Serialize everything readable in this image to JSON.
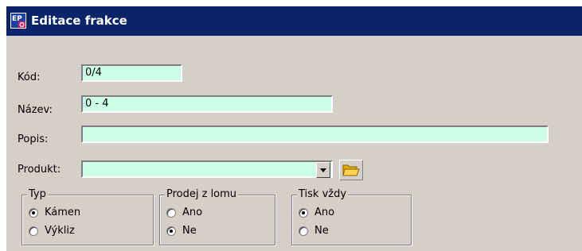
{
  "window": {
    "title": "Editace frakce"
  },
  "form": {
    "kod": {
      "label": "Kód:",
      "value": "0/4"
    },
    "nazev": {
      "label": "Název:",
      "value": "0 - 4"
    },
    "popis": {
      "label": "Popis:",
      "value": ""
    },
    "produkt": {
      "label": "Produkt:",
      "value": ""
    }
  },
  "groups": {
    "typ": {
      "label": "Typ",
      "options": [
        "Kámen",
        "Výkliz"
      ],
      "selected": "Kámen"
    },
    "prodej": {
      "label": "Prodej z lomu",
      "options": [
        "Ano",
        "Ne"
      ],
      "selected": "Ne"
    },
    "tisk": {
      "label": "Tisk vždy",
      "options": [
        "Ano",
        "Ne"
      ],
      "selected": "Ano"
    }
  },
  "icons": {
    "app": "ep-app-icon",
    "dropdown": "chevron-down-icon",
    "browse": "folder-open-icon"
  },
  "colors": {
    "titlebar": "#0a246a",
    "field": "#ccffe6",
    "window": "#d4d0c8"
  }
}
